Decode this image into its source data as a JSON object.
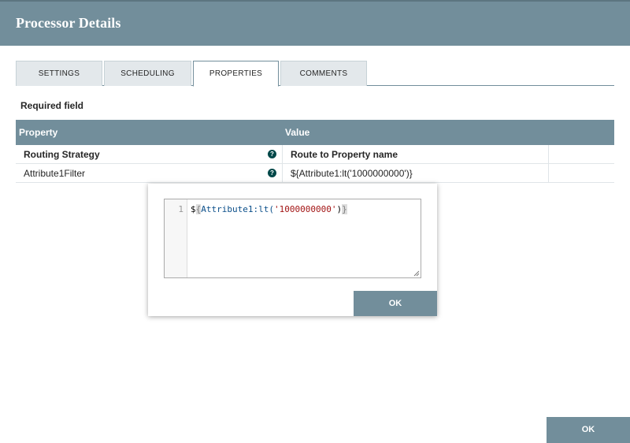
{
  "header": {
    "title": "Processor Details"
  },
  "tabs": [
    {
      "label": "SETTINGS"
    },
    {
      "label": "SCHEDULING"
    },
    {
      "label": "PROPERTIES"
    },
    {
      "label": "COMMENTS"
    }
  ],
  "active_tab": "PROPERTIES",
  "required_label": "Required field",
  "grid": {
    "columns": [
      "Property",
      "Value"
    ],
    "rows": [
      {
        "name": "Routing Strategy",
        "value": "Route to Property name",
        "help": "?"
      },
      {
        "name": "Attribute1Filter",
        "value": "${Attribute1:lt('1000000000')}",
        "help": "?"
      }
    ]
  },
  "editor": {
    "line_number": "1",
    "code": {
      "dollar": "$",
      "open_brace": "{",
      "attr": "Attribute1",
      "colon_fn": ":lt(",
      "str": "'1000000000'",
      "close_paren": ")",
      "close_brace": "}"
    },
    "ok_label": "OK"
  },
  "footer": {
    "ok_label": "OK"
  },
  "colors": {
    "header": "#728e9b",
    "tab_inactive": "#e3e8eb",
    "help_icon": "#004849"
  }
}
